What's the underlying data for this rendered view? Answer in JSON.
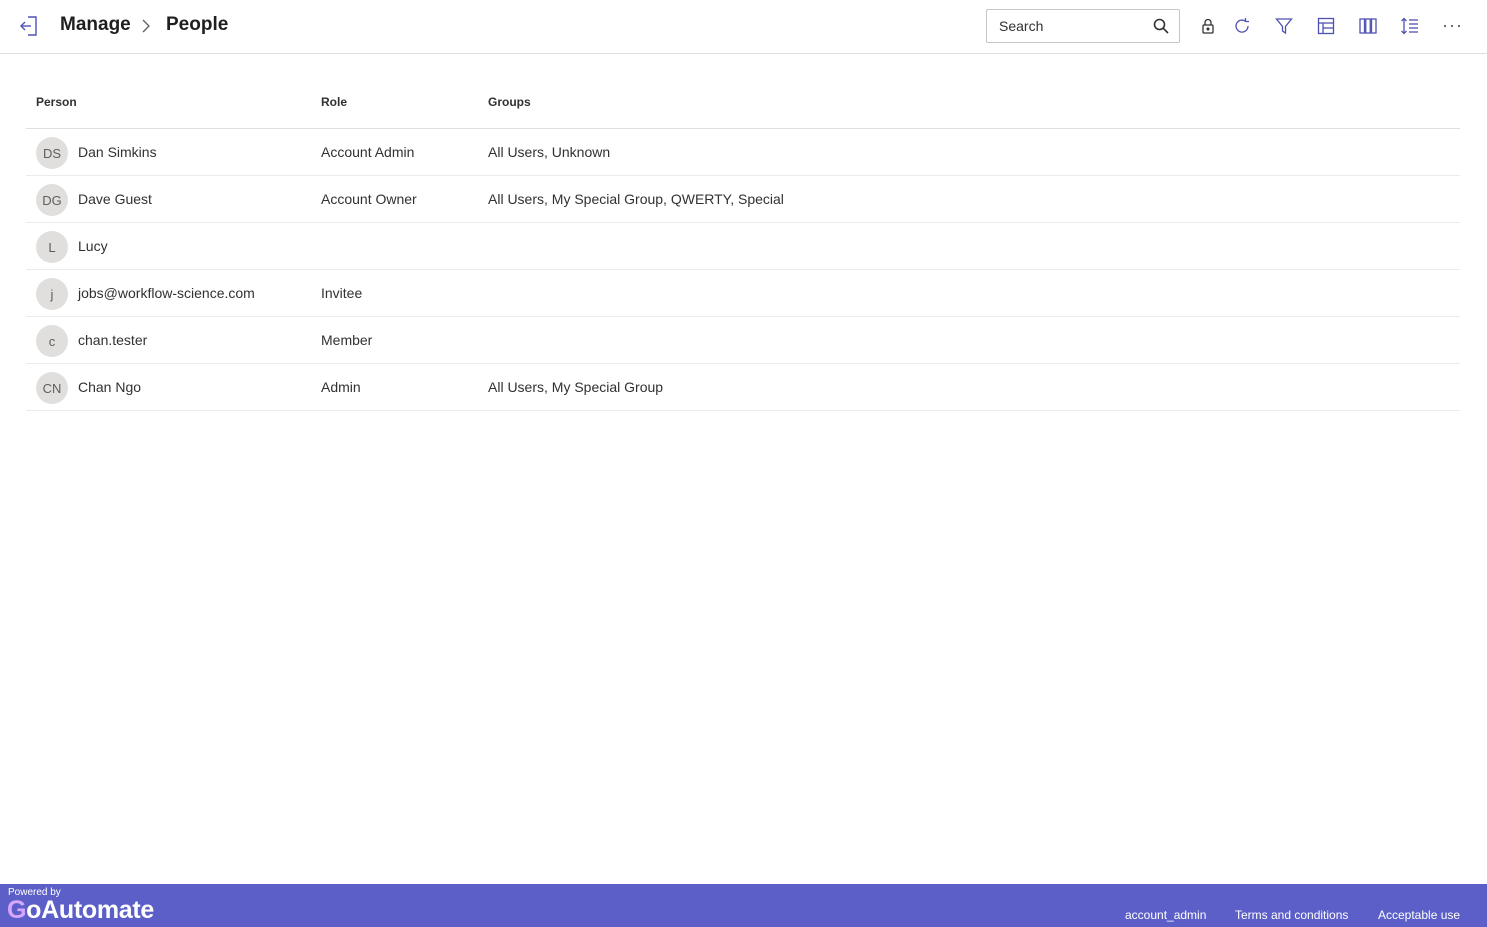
{
  "header": {
    "breadcrumb_root": "Manage",
    "breadcrumb_current": "People"
  },
  "search": {
    "placeholder": "Search",
    "value": ""
  },
  "table": {
    "columns": [
      "Person",
      "Role",
      "Groups"
    ],
    "rows": [
      {
        "initials": "DS",
        "name": "Dan Simkins",
        "role": "Account Admin",
        "groups": "All Users, Unknown"
      },
      {
        "initials": "DG",
        "name": "Dave Guest",
        "role": "Account Owner",
        "groups": "All Users, My Special Group, QWERTY, Special"
      },
      {
        "initials": "L",
        "name": "Lucy",
        "role": "",
        "groups": ""
      },
      {
        "initials": "j",
        "name": "jobs@workflow-science.com",
        "role": "Invitee",
        "groups": ""
      },
      {
        "initials": "c",
        "name": "chan.tester",
        "role": "Member",
        "groups": ""
      },
      {
        "initials": "CN",
        "name": "Chan Ngo",
        "role": "Admin",
        "groups": "All Users, My Special Group"
      }
    ]
  },
  "footer": {
    "powered_by": "Powered by",
    "brand_g": "G",
    "brand_rest": "oAutomate",
    "links": [
      "account_admin",
      "Terms and conditions",
      "Acceptable use"
    ]
  },
  "colors": {
    "accent": "#5b5fc7",
    "icon": "#4f52b2"
  }
}
